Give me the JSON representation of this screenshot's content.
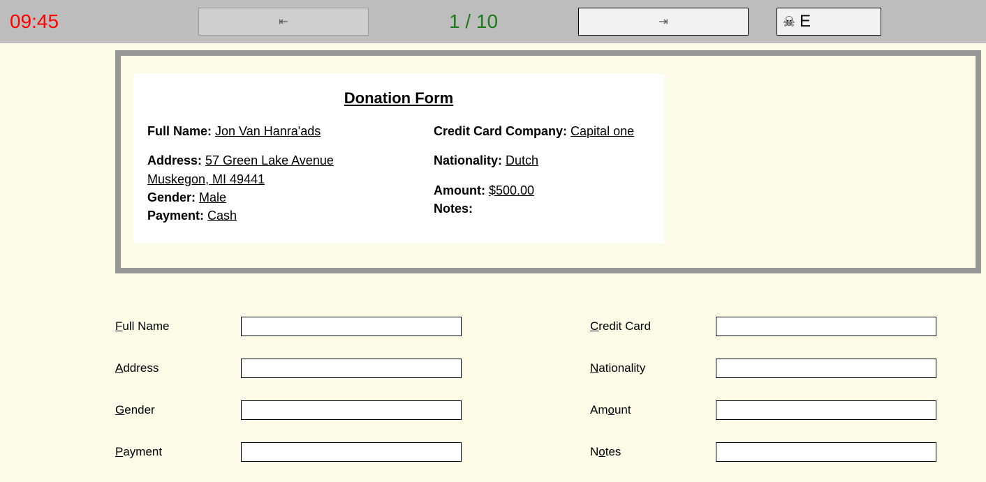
{
  "top": {
    "timer": "09:45",
    "counter": "1 / 10",
    "exit_letter": "E",
    "prev_glyph": "⇤",
    "next_glyph": "⇥"
  },
  "slide": {
    "title": "Donation Form",
    "left": {
      "full_name_label": "Full Name: ",
      "full_name_value": "Jon Van Hanra'ads",
      "address_label": "Address: ",
      "address_line1": "57 Green Lake Avenue",
      "address_line2": "Muskegon, MI 49441",
      "gender_label": "Gender: ",
      "gender_value": "Male",
      "payment_label": "Payment: ",
      "payment_value": "Cash"
    },
    "right": {
      "cc_label": "Credit Card Company: ",
      "cc_value": "Capital one",
      "nat_label": "Nationality: ",
      "nat_value": "Dutch",
      "amount_label": "Amount: ",
      "amount_value": "$500.00",
      "notes_label": "Notes:",
      "notes_value": ""
    }
  },
  "form": {
    "full_name": {
      "pre": "F",
      "rest": "ull Name",
      "value": ""
    },
    "address": {
      "pre": "A",
      "rest": "ddress",
      "value": ""
    },
    "gender": {
      "pre": "G",
      "rest": "ender",
      "value": ""
    },
    "payment": {
      "pre": "P",
      "rest": "ayment",
      "value": ""
    },
    "cc": {
      "pre": "C",
      "rest": "redit Card",
      "value": ""
    },
    "nationality": {
      "pre": "N",
      "rest": "ationality",
      "value": ""
    },
    "amount": {
      "pre": "Am",
      "ul": "o",
      "rest2": "unt",
      "value": ""
    },
    "notes": {
      "pre": "N",
      "ul": "o",
      "rest2": "tes",
      "value": ""
    }
  }
}
